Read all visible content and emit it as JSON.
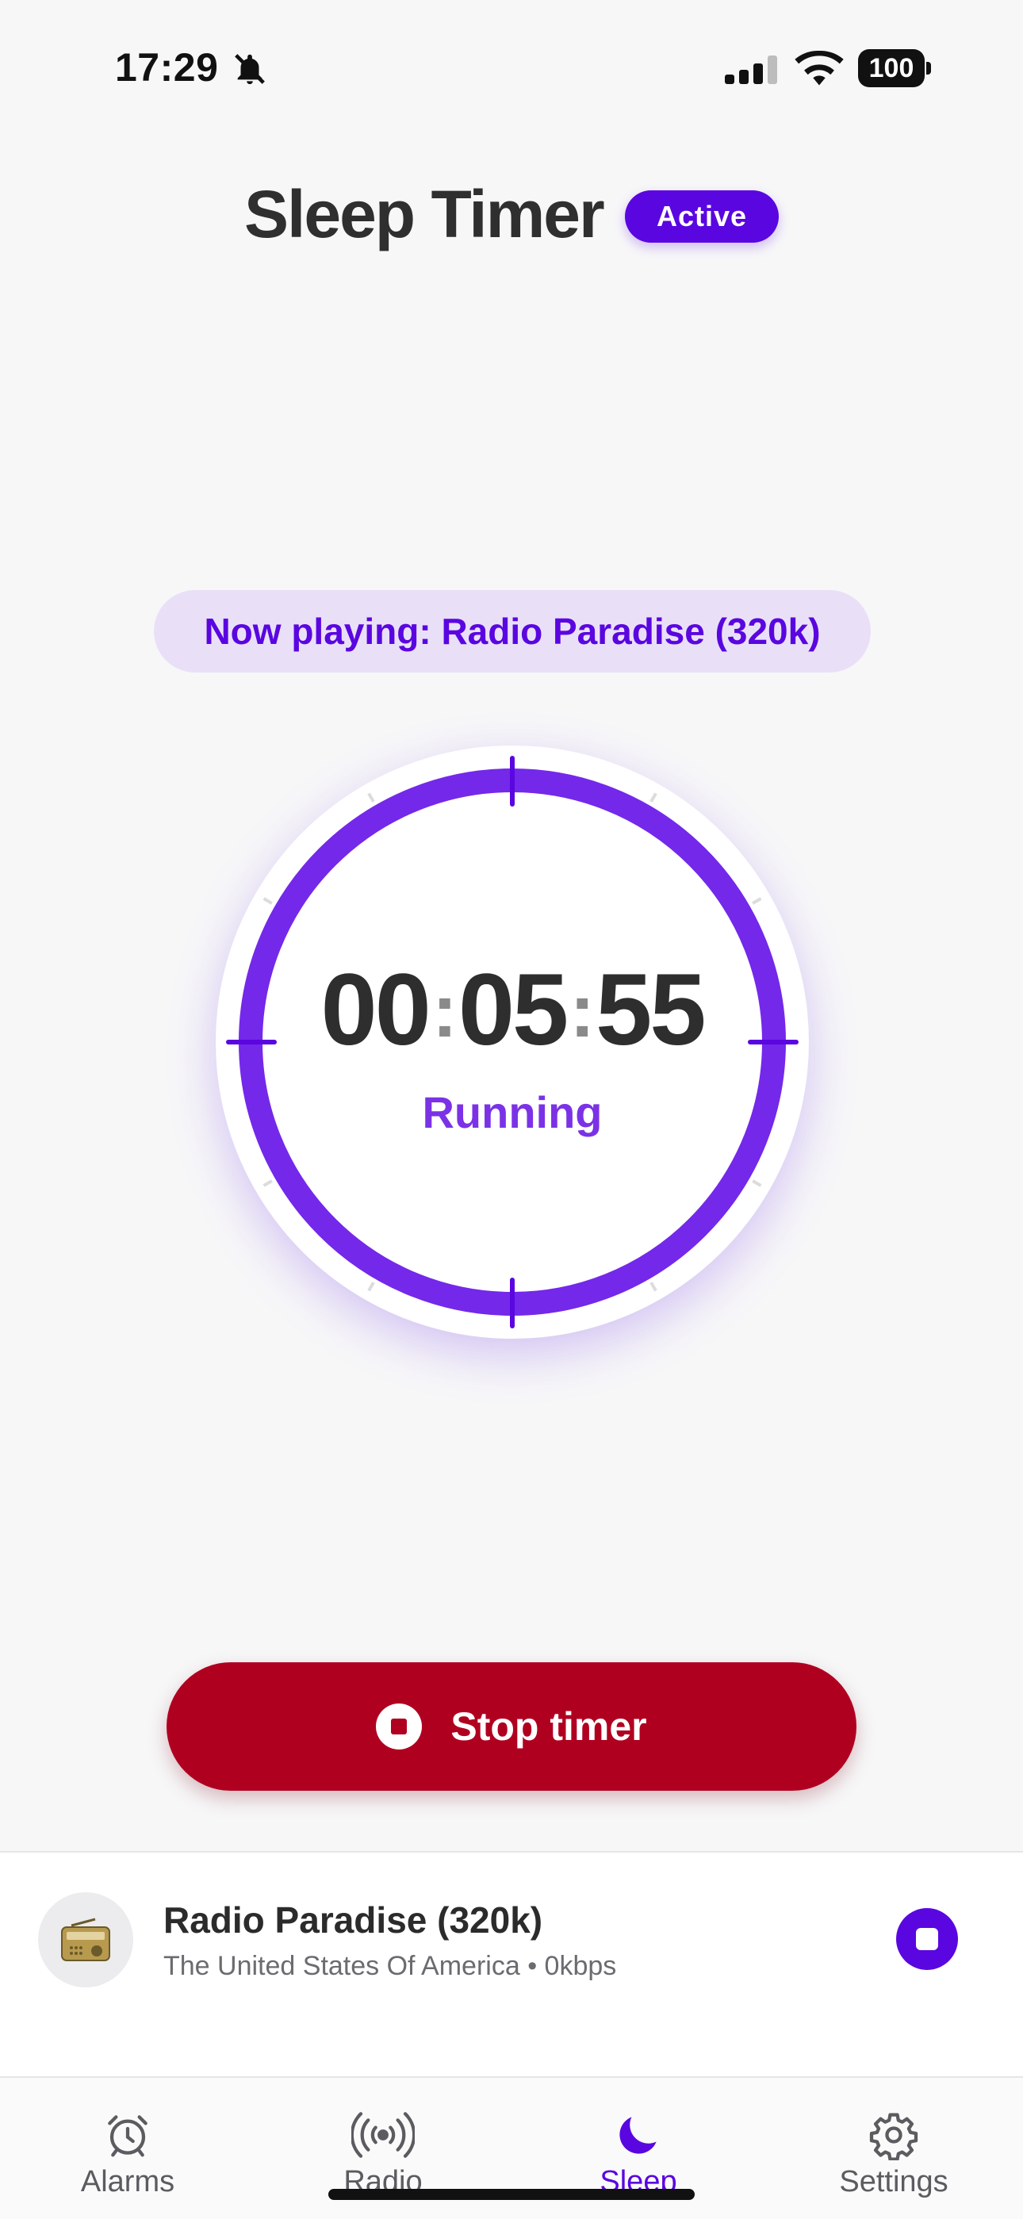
{
  "status_bar": {
    "time": "17:29",
    "battery": "100"
  },
  "header": {
    "title": "Sleep Timer",
    "badge": "Active"
  },
  "now_playing": "Now playing: Radio Paradise (320k)",
  "timer": {
    "hours": "00",
    "minutes": "05",
    "seconds": "55",
    "separator": ":",
    "status": "Running",
    "progress": 1.0
  },
  "stop_button": {
    "label": "Stop timer"
  },
  "mini_player": {
    "station_name": "Radio Paradise (320k)",
    "station_meta": "The United States Of America • 0kbps"
  },
  "tabs": [
    {
      "label": "Alarms",
      "icon": "alarm-clock-icon"
    },
    {
      "label": "Radio",
      "icon": "radio-waves-icon"
    },
    {
      "label": "Sleep",
      "icon": "moon-icon",
      "active": true
    },
    {
      "label": "Settings",
      "icon": "gear-icon"
    }
  ],
  "colors": {
    "accent": "#5a06e0",
    "danger": "#b00020",
    "ring": "#7428ea",
    "pill_bg": "#e9e0f8"
  }
}
